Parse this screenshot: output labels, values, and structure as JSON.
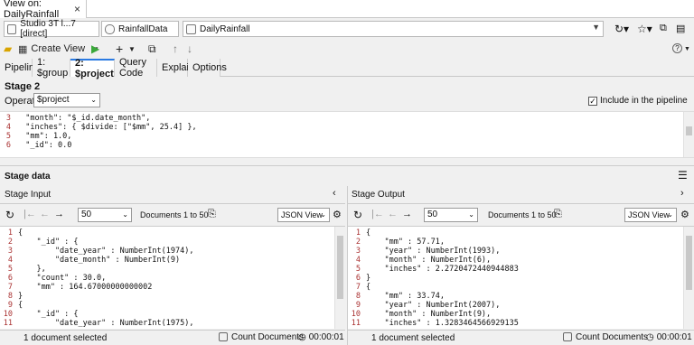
{
  "tab": {
    "label": "View on: DailyRainfall",
    "close": "×"
  },
  "breadcrumb": {
    "connection": "Studio 3T l...7 [direct]",
    "database": "RainfallData",
    "collection": "DailyRainfall"
  },
  "toolbar": {
    "create_view": "Create View",
    "help": "?"
  },
  "subtabs": [
    "Pipeline",
    "1: $group",
    "2: $project",
    "Query Code",
    "Explain",
    "Options"
  ],
  "stage": {
    "title": "Stage 2",
    "operator_label": "Operator:",
    "operator_value": "$project",
    "include_label": "Include in the pipeline"
  },
  "editor": {
    "lines": [
      {
        "n": "3",
        "text": "  \"month\": \"$_id.date_month\","
      },
      {
        "n": "4",
        "text": "  \"inches\": { $divide: [\"$mm\", 25.4] },"
      },
      {
        "n": "5",
        "text": "  \"mm\": 1.0,"
      },
      {
        "n": "6",
        "text": "  \"_id\": 0.0"
      }
    ]
  },
  "stage_data": {
    "title": "Stage data"
  },
  "input": {
    "title": "Stage Input",
    "page_size": "50",
    "docs": "Documents 1 to 50",
    "view": "JSON View",
    "status": "1 document selected",
    "count": "Count Documents",
    "timer": "00:00:01",
    "lines": [
      {
        "n": "1",
        "text": "{"
      },
      {
        "n": "2",
        "text": "    \"_id\" : {"
      },
      {
        "n": "3",
        "text": "        \"date_year\" : NumberInt(1974),"
      },
      {
        "n": "4",
        "text": "        \"date_month\" : NumberInt(9)"
      },
      {
        "n": "5",
        "text": "    },"
      },
      {
        "n": "6",
        "text": "    \"count\" : 30.0,"
      },
      {
        "n": "7",
        "text": "    \"mm\" : 164.67000000000002"
      },
      {
        "n": "8",
        "text": "}"
      },
      {
        "n": "9",
        "text": "{"
      },
      {
        "n": "10",
        "text": "    \"_id\" : {"
      },
      {
        "n": "11",
        "text": "        \"date_year\" : NumberInt(1975),"
      }
    ]
  },
  "output": {
    "title": "Stage Output",
    "page_size": "50",
    "docs": "Documents 1 to 50",
    "view": "JSON View",
    "status": "1 document selected",
    "count": "Count Documents",
    "timer": "00:00:01",
    "lines": [
      {
        "n": "1",
        "text": "{"
      },
      {
        "n": "2",
        "text": "    \"mm\" : 57.71,"
      },
      {
        "n": "3",
        "text": "    \"year\" : NumberInt(1993),"
      },
      {
        "n": "4",
        "text": "    \"month\" : NumberInt(6),"
      },
      {
        "n": "5",
        "text": "    \"inches\" : 2.2720472440944883"
      },
      {
        "n": "6",
        "text": "}"
      },
      {
        "n": "7",
        "text": "{"
      },
      {
        "n": "8",
        "text": "    \"mm\" : 33.74,"
      },
      {
        "n": "9",
        "text": "    \"year\" : NumberInt(2007),"
      },
      {
        "n": "10",
        "text": "    \"month\" : NumberInt(9),"
      },
      {
        "n": "11",
        "text": "    \"inches\" : 1.3283464566929135"
      }
    ]
  }
}
